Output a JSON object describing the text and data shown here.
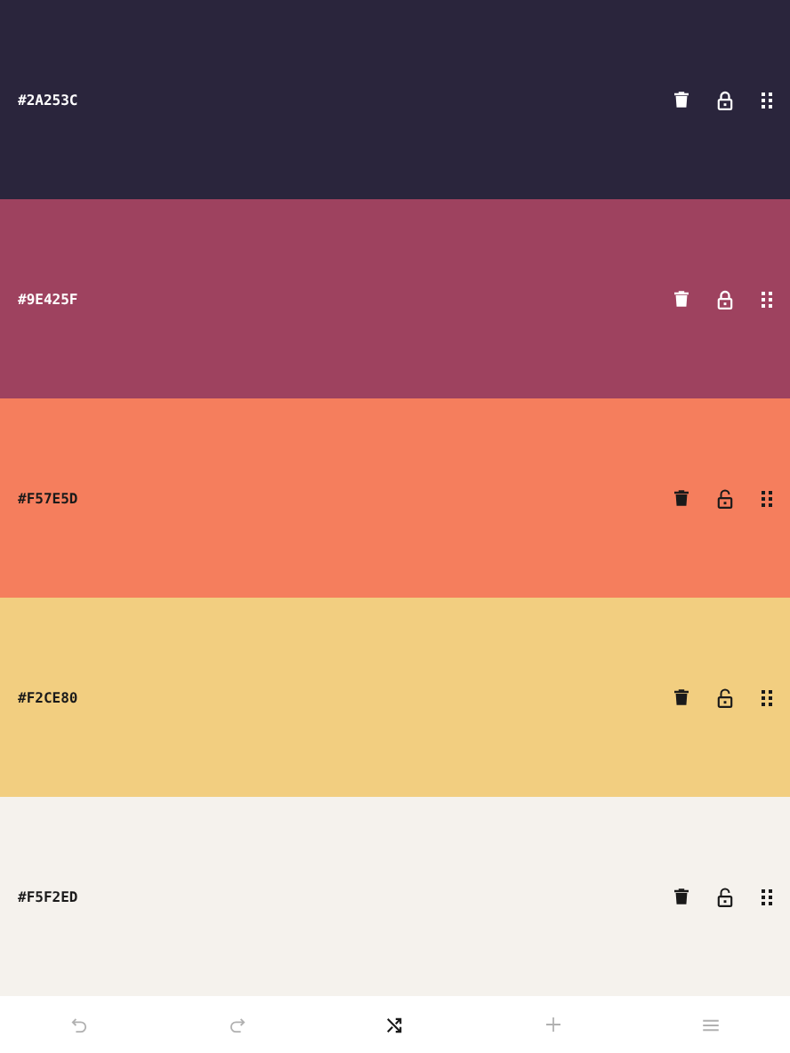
{
  "swatches": [
    {
      "hex": "#2A253C",
      "color": "#2a253c",
      "kind": "dark",
      "locked": true
    },
    {
      "hex": "#9E425F",
      "color": "#9e425f",
      "kind": "dark",
      "locked": true
    },
    {
      "hex": "#F57E5D",
      "color": "#f57e5d",
      "kind": "light",
      "locked": false
    },
    {
      "hex": "#F2CE80",
      "color": "#f2ce80",
      "kind": "light",
      "locked": false
    },
    {
      "hex": "#F5F2ED",
      "color": "#f5f2ed",
      "kind": "light",
      "locked": false
    }
  ],
  "toolbar": [
    {
      "kind": "undo",
      "disabled": true
    },
    {
      "kind": "redo",
      "disabled": true
    },
    {
      "kind": "shuffle",
      "disabled": false
    },
    {
      "kind": "add",
      "disabled": true
    },
    {
      "kind": "menu",
      "disabled": true
    }
  ]
}
